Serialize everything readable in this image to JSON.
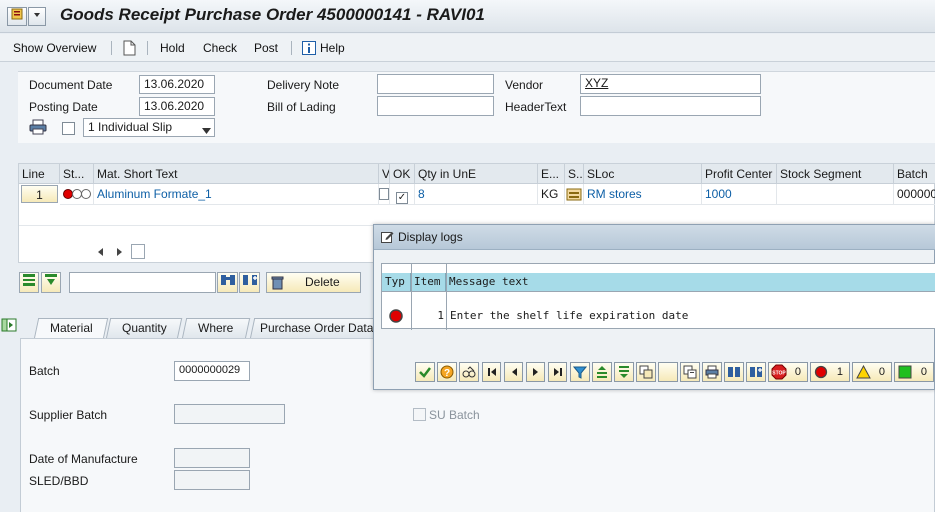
{
  "window": {
    "title": "Goods Receipt Purchase Order 4500000141 - RAVI01"
  },
  "toolbar": {
    "show_overview": "Show Overview",
    "hold": "Hold",
    "check": "Check",
    "post": "Post",
    "help": "Help"
  },
  "header": {
    "document_date_label": "Document Date",
    "document_date": "13.06.2020",
    "posting_date_label": "Posting Date",
    "posting_date": "13.06.2020",
    "delivery_note_label": "Delivery Note",
    "delivery_note": "",
    "bill_of_lading_label": "Bill of Lading",
    "bill_of_lading": "",
    "vendor_label": "Vendor",
    "vendor": "XYZ",
    "header_text_label": "HeaderText",
    "header_text": "",
    "slip_option": "1 Individual Slip"
  },
  "table": {
    "columns": [
      "Line",
      "St...",
      "Mat. Short Text",
      "V",
      "OK",
      "Qty in UnE",
      "E...",
      "S...",
      "SLoc",
      "Profit Center",
      "Stock Segment",
      "Batch"
    ],
    "row": {
      "line": "1",
      "mat_text": "Aluminum Formate_1",
      "qty": "8",
      "unit": "KG",
      "sloc": "RM stores",
      "profit_center": "1000",
      "batch": "000000"
    }
  },
  "item_toolbar": {
    "delete_label": "Delete"
  },
  "tabs": [
    "Material",
    "Quantity",
    "Where",
    "Purchase Order Data"
  ],
  "detail": {
    "batch_label": "Batch",
    "batch": "0000000029",
    "supplier_batch_label": "Supplier Batch",
    "su_batch_label": "SU Batch",
    "date_of_manufacture_label": "Date of Manufacture",
    "sled_label": "SLED/BBD"
  },
  "dialog": {
    "title": "Display logs",
    "columns": [
      "Typ",
      "Item",
      "Message text"
    ],
    "message": {
      "item": "1",
      "text": "Enter the shelf life expiration date"
    },
    "counts": {
      "stop": "0",
      "error": "1",
      "warning": "0",
      "success": "0"
    }
  },
  "colors": {
    "accent": "#0d5fa6",
    "header_cell": "#a6dbe8",
    "error": "#e00000"
  }
}
